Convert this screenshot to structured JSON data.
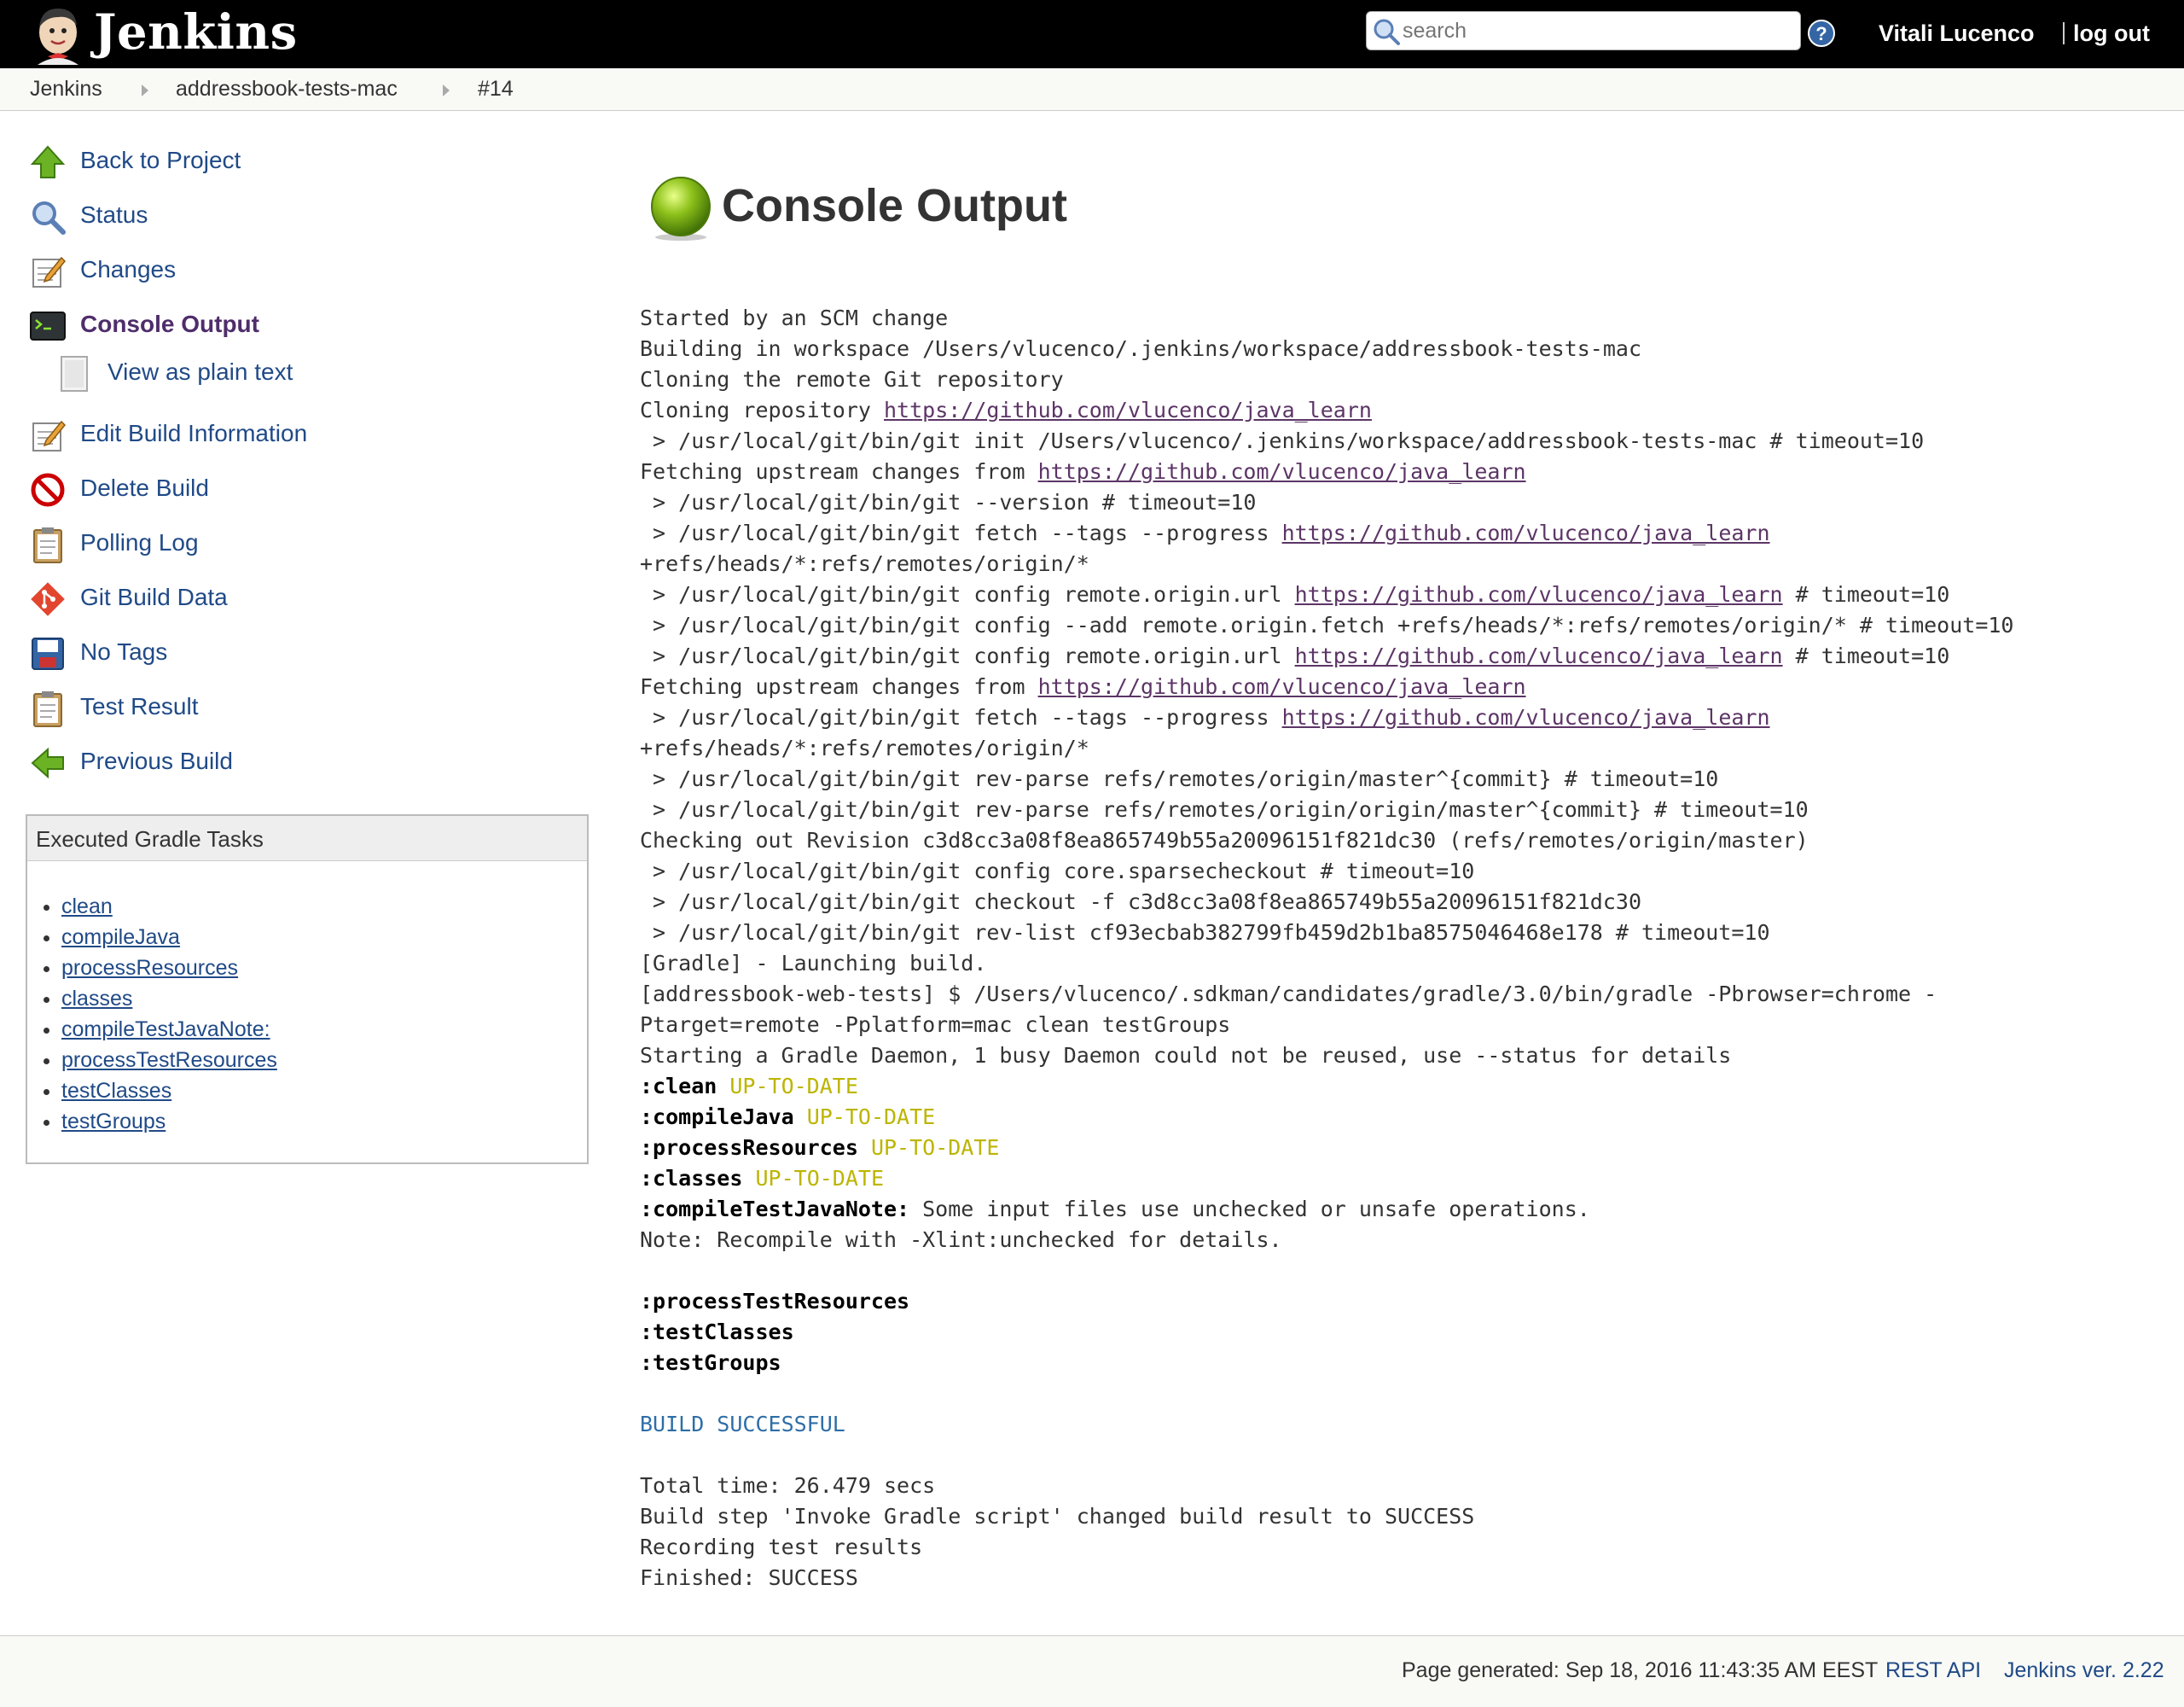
{
  "header": {
    "title": "Jenkins",
    "search_placeholder": "search",
    "user": "Vitali Lucenco",
    "logout": "log out"
  },
  "breadcrumbs": [
    "Jenkins",
    "addressbook-tests-mac",
    "#14"
  ],
  "sidebar": {
    "tasks": [
      {
        "label": "Back to Project",
        "icon": "up-arrow-icon"
      },
      {
        "label": "Status",
        "icon": "magnifier-icon"
      },
      {
        "label": "Changes",
        "icon": "notepad-icon"
      },
      {
        "label": "Console Output",
        "icon": "terminal-icon",
        "active": true
      },
      {
        "label": "View as plain text",
        "icon": "document-icon"
      },
      {
        "label": "Edit Build Information",
        "icon": "notepad-icon"
      },
      {
        "label": "Delete Build",
        "icon": "no-entry-icon"
      },
      {
        "label": "Polling Log",
        "icon": "clipboard-icon"
      },
      {
        "label": "Git Build Data",
        "icon": "git-icon"
      },
      {
        "label": "No Tags",
        "icon": "save-icon"
      },
      {
        "label": "Test Result",
        "icon": "clipboard-icon"
      },
      {
        "label": "Previous Build",
        "icon": "left-arrow-icon"
      }
    ],
    "gradle": {
      "title": "Executed Gradle Tasks",
      "items": [
        "clean",
        "compileJava",
        "processResources",
        "classes",
        "compileTestJavaNote:",
        "processTestResources",
        "testClasses",
        "testGroups"
      ]
    }
  },
  "main": {
    "title": "Console Output",
    "status_color": "#8ec21b",
    "console": {
      "l1": "Started by an SCM change",
      "l2": "Building in workspace /Users/vlucenco/.jenkins/workspace/addressbook-tests-mac",
      "l3": "Cloning the remote Git repository",
      "l4a": "Cloning repository ",
      "repo": "https://github.com/vlucenco/java_learn",
      "l5": " > /usr/local/git/bin/git init /Users/vlucenco/.jenkins/workspace/addressbook-tests-mac # timeout=10",
      "l6a": "Fetching upstream changes from ",
      "l7": " > /usr/local/git/bin/git --version # timeout=10",
      "l8a": " > /usr/local/git/bin/git fetch --tags --progress ",
      "l9": "+refs/heads/*:refs/remotes/origin/*",
      "l10a": " > /usr/local/git/bin/git config remote.origin.url ",
      "l10b": " # timeout=10",
      "l11": " > /usr/local/git/bin/git config --add remote.origin.fetch +refs/heads/*:refs/remotes/origin/* # timeout=10",
      "l12a": " > /usr/local/git/bin/git config remote.origin.url ",
      "l12b": " # timeout=10",
      "l13a": "Fetching upstream changes from ",
      "l14a": " > /usr/local/git/bin/git fetch --tags --progress ",
      "l15": "+refs/heads/*:refs/remotes/origin/*",
      "l16": " > /usr/local/git/bin/git rev-parse refs/remotes/origin/master^{commit} # timeout=10",
      "l17": " > /usr/local/git/bin/git rev-parse refs/remotes/origin/origin/master^{commit} # timeout=10",
      "l18": "Checking out Revision c3d8cc3a08f8ea865749b55a20096151f821dc30 (refs/remotes/origin/master)",
      "l19": " > /usr/local/git/bin/git config core.sparsecheckout # timeout=10",
      "l20": " > /usr/local/git/bin/git checkout -f c3d8cc3a08f8ea865749b55a20096151f821dc30",
      "l21": " > /usr/local/git/bin/git rev-list cf93ecbab382799fb459d2b1ba8575046468e178 # timeout=10",
      "l22": "[Gradle] - Launching build.",
      "l23": "[addressbook-web-tests] $ /Users/vlucenco/.sdkman/candidates/gradle/3.0/bin/gradle -Pbrowser=chrome -",
      "l24": "Ptarget=remote -Pplatform=mac clean testGroups",
      "l25": "Starting a Gradle Daemon, 1 busy Daemon could not be reused, use --status for details",
      "t_clean": ":clean",
      "t_compileJava": ":compileJava",
      "t_processResources": ":processResources",
      "t_classes": ":classes",
      "t_compileTestJavaNote": ":compileTestJavaNote:",
      "uptodate": "UP-TO-DATE",
      "l30b": " Some input files use unchecked or unsafe operations.",
      "l31": "Note: Recompile with -Xlint:unchecked for details.",
      "t_processTestResources": ":processTestResources",
      "t_testClasses": ":testClasses",
      "t_testGroups": ":testGroups",
      "success": "BUILD SUCCESSFUL",
      "l38": "Total time: 26.479 secs",
      "l39": "Build step 'Invoke Gradle script' changed build result to SUCCESS",
      "l40": "Recording test results",
      "l41": "Finished: SUCCESS"
    }
  },
  "footer": {
    "generated": "Page generated: Sep 18, 2016 11:43:35 AM EEST",
    "rest_api": "REST API",
    "version": "Jenkins ver. 2.22"
  }
}
